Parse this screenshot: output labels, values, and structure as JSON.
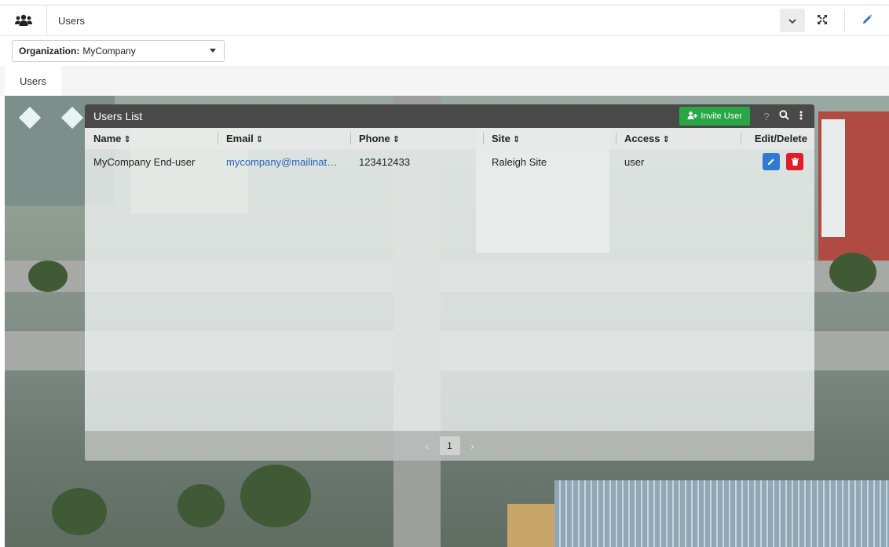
{
  "header": {
    "title": "Users",
    "app_icon": "users-icon",
    "buttons": [
      "chevron-down-icon",
      "expand-icon",
      "pencil-icon"
    ]
  },
  "org_selector": {
    "label": "Organization:",
    "value": "MyCompany"
  },
  "tabs": [
    {
      "label": "Users",
      "active": true
    }
  ],
  "panel": {
    "title": "Users List",
    "invite_label": "Invite User",
    "help_label": "?",
    "columns": [
      {
        "label": "Name",
        "sortable": true
      },
      {
        "label": "Email",
        "sortable": true
      },
      {
        "label": "Phone",
        "sortable": true
      },
      {
        "label": "Site",
        "sortable": true
      },
      {
        "label": "Access",
        "sortable": true
      },
      {
        "label": "Edit/Delete",
        "sortable": false
      }
    ],
    "rows": [
      {
        "name": "MyCompany End-user",
        "email": "mycompany@mailinator....",
        "phone": "123412433",
        "site": "Raleigh Site",
        "access": "user"
      }
    ],
    "pagination": {
      "current_page": "1",
      "prev": "‹",
      "next": "›"
    }
  },
  "colors": {
    "header_dark": "#494949",
    "invite_green": "#29a745",
    "edit_blue": "#2f7bd2",
    "delete_red": "#e01e2a",
    "link_blue": "#2a63b8"
  }
}
